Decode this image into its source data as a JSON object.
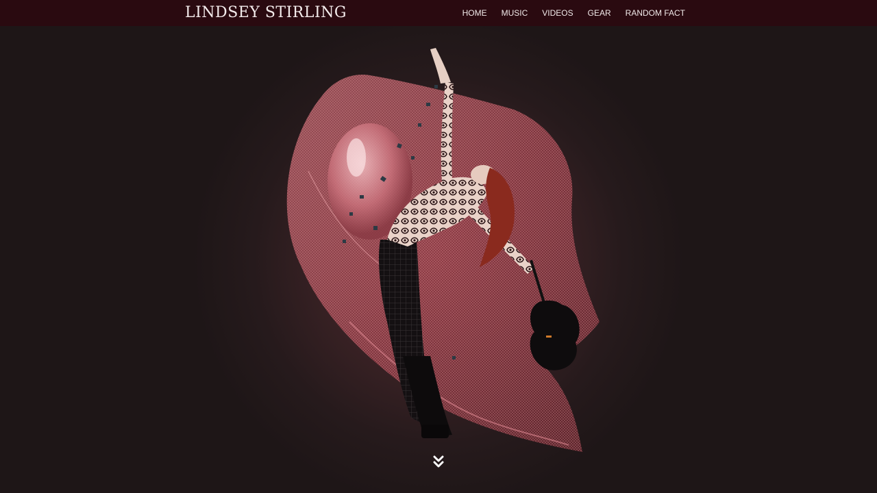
{
  "header": {
    "logo_text": "LINDSEY STIRLING",
    "nav": [
      {
        "label": "HOME"
      },
      {
        "label": "MUSIC"
      },
      {
        "label": "VIDEOS"
      },
      {
        "label": "GEAR"
      },
      {
        "label": "RANDOM FACT"
      }
    ]
  },
  "hero": {
    "image_icon": "dancer-with-violin-image",
    "scroll_icon": "double-chevron-down-icon"
  },
  "colors": {
    "header_bg": "#2a0a10",
    "page_bg": "#1f1618",
    "accent_fabric": "#c9606a"
  }
}
